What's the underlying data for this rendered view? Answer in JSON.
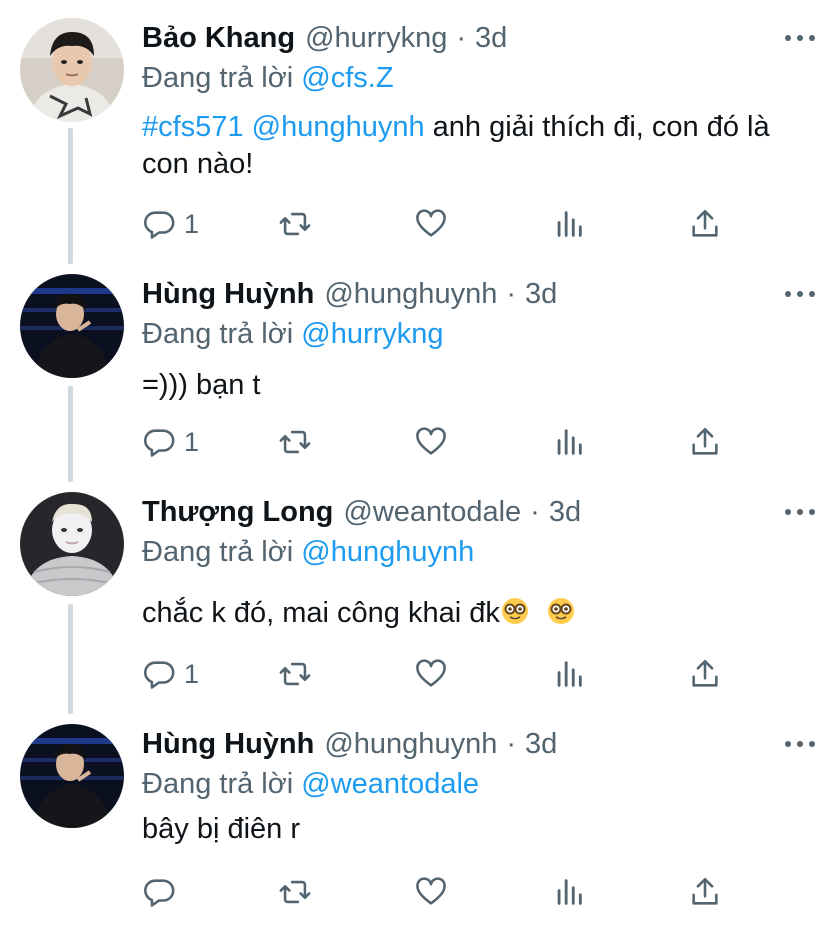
{
  "tweets": [
    {
      "name": "Bảo Khang",
      "handle": "@hurrykng",
      "separator": "·",
      "time": "3d",
      "reply_prefix": "Đang trả lời",
      "reply_to": "@cfs.Z",
      "hashtag": "#cfs571",
      "mention": "@hunghuynh",
      "text": " anh giải thích đi, con đó là con nào!",
      "reply_count": "1"
    },
    {
      "name": "Hùng Huỳnh",
      "handle": "@hunghuynh",
      "separator": "·",
      "time": "3d",
      "reply_prefix": "Đang trả lời",
      "reply_to": "@hurrykng",
      "text": "=))) bạn t",
      "reply_count": "1"
    },
    {
      "name": "Thượng Long",
      "handle": "@weantodale",
      "separator": "·",
      "time": "3d",
      "reply_prefix": "Đang trả lời",
      "reply_to": "@hunghuynh",
      "text": "chắc k đó, mai công khai đk",
      "emojis": [
        "nerd-face-emoji",
        "nerd-face-emoji"
      ],
      "reply_count": "1"
    },
    {
      "name": "Hùng Huỳnh",
      "handle": "@hunghuynh",
      "separator": "·",
      "time": "3d",
      "reply_prefix": "Đang trả lời",
      "reply_to": "@weantodale",
      "text": "bây bị điên r",
      "reply_count": ""
    }
  ],
  "icons": [
    "reply-icon",
    "retweet-icon",
    "like-icon",
    "analytics-icon",
    "share-icon",
    "more-options-icon"
  ],
  "colors": {
    "accent": "#1d9bf0",
    "secondary_text": "#536471",
    "thread_line": "#cfd9de"
  }
}
